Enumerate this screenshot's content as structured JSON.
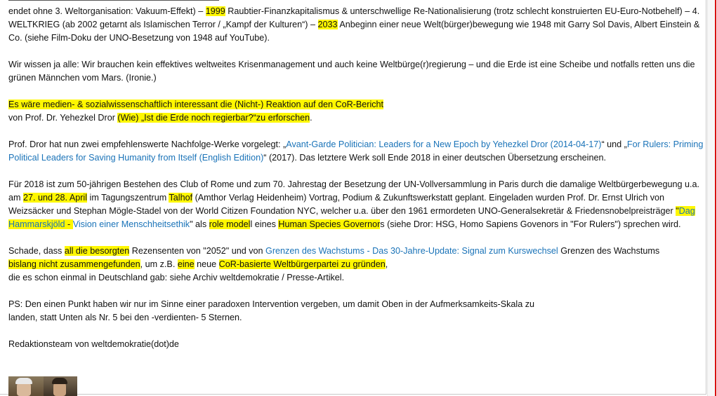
{
  "review": {
    "p1": {
      "s1": "endet ohne 3. Weltorganisation: Vakuum-Effekt) – ",
      "h1": "1999",
      "s2": " Raubtier-Finanzkapitalismus & unterschwellige Re-Nationalisierung (trotz schlecht konstruierten EU-Euro-Notbehelf) – 4. WELTKRIEG (ab 2002 getarnt als Islamischen Terror / „Kampf der Kulturen“) – ",
      "h2": "2033",
      "s3": " Anbeginn einer neue Welt(bürger)bewegung wie 1948 mit Garry Sol Davis, Albert Einstein & Co. (siehe Film-Doku der UNO-Besetzung von 1948 auf YouTube)."
    },
    "p2": "Wir wissen ja alle: Wir brauchen kein effektives weltweites Krisenmanagement und auch keine Weltbürge(r)regierung – und die Erde ist eine Scheibe und notfalls retten uns die grünen Männchen vom Mars. (Ironie.)",
    "p3": {
      "h1": "Es wäre medien- & sozialwissenschaftlich interessant die (Nicht-) Reaktion auf den CoR-Bericht",
      "s1": "von Prof. Dr. Yehezkel Dror ",
      "h2": "(Wie) „Ist die Erde noch regierbar?“zu erforschen",
      "s2": "."
    },
    "p4": {
      "s1": "Prof. Dror hat nun zwei empfehlenswerte Nachfolge-Werke vorgelegt: „",
      "link1": "Avant-Garde Politician: Leaders for a New Epoch by Yehezkel Dror (2014-04-17)",
      "s2": "“ und „",
      "link2": "For Rulers: Priming Political Leaders for Saving Humanity from Itself (English Edition)",
      "s3": "“ (2017). Das letztere Werk soll Ende 2018 in einer deutschen Übersetzung erscheinen."
    },
    "p5": {
      "s1": "Für 2018 ist zum 50-jährigen Bestehen des Club of Rome und zum 70. Jahrestag der Besetzung der UN-Vollversammlung in Paris durch die damalige Weltbürgerbewegung u.a. am ",
      "h1": "27. und 28. April",
      "s2": " im Tagungszentrum ",
      "h2": "Talhof",
      "s3": " (Amthor Verlag Heidenheim) Vortrag, Podium & Zukunftswerkstatt geplant. Eingeladen wurden Prof. Dr. Ernst Ulrich von Weizsäcker und Stephan Mögle-Stadel von der World Citizen Foundation NYC, welcher u.a. über den 1961 ermordeten UNO-Generalsekretär & Friedensnobelpreisträger ",
      "h3a": "\"",
      "h3link": "Dag Hammarskjöld",
      "h3b": " - ",
      "link": "Vision einer Menschheitsethik",
      "s4": "\" als ",
      "h4": "role model",
      "s5": "l eines ",
      "h5": "Human Species Governor",
      "s6": "s (siehe Dror: HSG, Homo Sapiens Govenors in \"For Rulers\") sprechen wird."
    },
    "p6": {
      "s1": "Schade, dass ",
      "h1": "all die besorgten",
      "s2": " Rezensenten von \"2052\" und von ",
      "link": "Grenzen des Wachstums - Das 30-Jahre-Update: Signal zum Kurswechsel",
      "s3": " Grenzen des Wachstums",
      "h2": "bislang nicht zusammengefunden",
      "s4": ", um z.B. ",
      "h3": "eine",
      "s5": " neue ",
      "h4": "CoR-basierte Weltbürgerpartei zu gründen",
      "s6": ",",
      "s7": "die es schon einmal in Deutschland gab: siehe Archiv weltdemokratie / Presse-Artikel."
    },
    "p7": {
      "line1": "PS: Den einen Punkt haben wir nur im Sinne einer paradoxen Intervention vergeben, um damit Oben in der Aufmerksamkeits-Skala zu",
      "line2": "landen, statt Unten als Nr. 5 bei den -verdienten- 5 Sternen."
    },
    "p8": "Redaktionsteam von weltdemokratie(dot)de"
  },
  "colors": {
    "highlight": "#fff700",
    "link": "#1a73b8",
    "text": "#111111"
  }
}
